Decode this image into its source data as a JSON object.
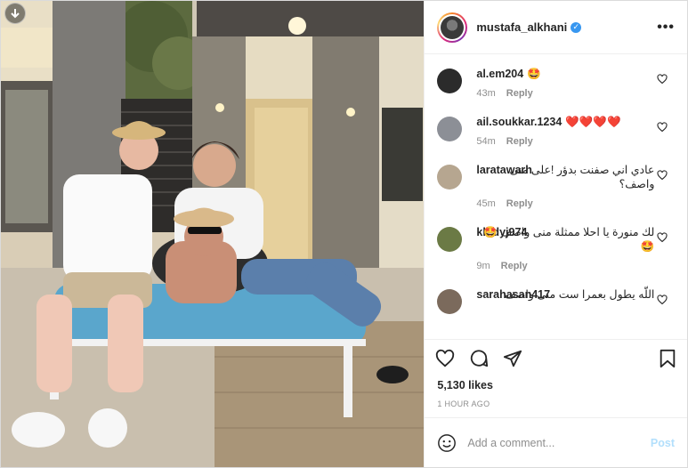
{
  "post": {
    "owner": "mustafa_alkhani",
    "verified_icon": "verified-badge-icon",
    "more_icon": "more-options-icon",
    "likes": "5,130 likes",
    "time": "1 HOUR AGO"
  },
  "comments": [
    {
      "user": "al.em204",
      "text": "🤩",
      "age": "43m",
      "reply": "Reply",
      "rtl": false,
      "avatar_color": "#2b2b2b"
    },
    {
      "user": "ail.soukkar.1234",
      "text": "❤️❤️❤️❤️",
      "age": "54m",
      "reply": "Reply",
      "rtl": false,
      "avatar_color": "#8c8f96"
    },
    {
      "user": "laratawarh",
      "text": "عادي اني صفنت بدؤر !على منى واصف؟",
      "age": "45m",
      "reply": "Reply",
      "rtl": true,
      "avatar_color": "#b6a690"
    },
    {
      "user": "kh.dyj974",
      "text": "لك منورة يا احلا ممثلة منى واصف 🤩🤩",
      "age": "9m",
      "reply": "Reply",
      "rtl": true,
      "avatar_color": "#6b7a45"
    },
    {
      "user": "sarahasan417",
      "text": "اللّه يطول بعمرا ست منى واصف",
      "age": "",
      "reply": "",
      "rtl": true,
      "avatar_color": "#7b6a5c"
    }
  ],
  "add_comment": {
    "placeholder": "Add a comment...",
    "post_label": "Post"
  },
  "colors": {
    "border": "#dbdbdb",
    "muted": "#8e8e8e",
    "link_disabled": "#b2dffc",
    "verified": "#3897f0"
  }
}
